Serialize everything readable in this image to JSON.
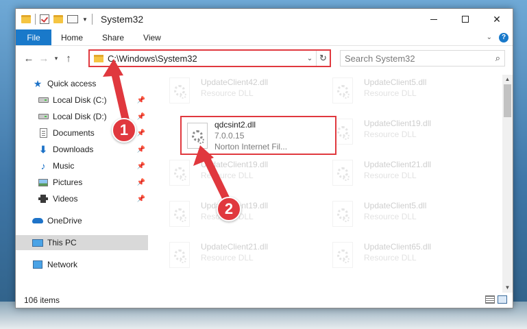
{
  "window": {
    "title": "System32",
    "min_glyph": "",
    "close_glyph": "✕"
  },
  "ribbon": {
    "tabs": [
      "File",
      "Home",
      "Share",
      "View"
    ]
  },
  "address": {
    "path": "C:\\Windows\\System32",
    "search_placeholder": "Search System32"
  },
  "sidebar": {
    "items": [
      {
        "label": "Quick access",
        "icon": "star-icon"
      },
      {
        "label": "Local Disk (C:)",
        "icon": "disk-icon",
        "pinned": true
      },
      {
        "label": "Local Disk (D:)",
        "icon": "disk-icon",
        "pinned": true
      },
      {
        "label": "Documents",
        "icon": "document-icon",
        "pinned": true
      },
      {
        "label": "Downloads",
        "icon": "download-icon",
        "pinned": true
      },
      {
        "label": "Music",
        "icon": "music-icon",
        "pinned": true
      },
      {
        "label": "Pictures",
        "icon": "pictures-icon",
        "pinned": true
      },
      {
        "label": "Videos",
        "icon": "videos-icon",
        "pinned": true
      },
      {
        "label": "OneDrive",
        "icon": "cloud-icon"
      },
      {
        "label": "This PC",
        "icon": "computer-icon",
        "selected": true
      },
      {
        "label": "Network",
        "icon": "network-icon"
      }
    ]
  },
  "files": {
    "highlighted": {
      "name": "qdcsint2.dll",
      "version": "7.0.0.15",
      "description": "Norton Internet Fil..."
    },
    "faded": [
      {
        "name": "UpdateClient42.dll",
        "type": "Resource DLL"
      },
      {
        "name": "UpdateClient5.dll",
        "type": "Resource DLL"
      },
      {
        "name": "UpdateClient19.dll",
        "type": "Resource DLL"
      },
      {
        "name": "UpdateClient19.dll",
        "type": "Resource DLL"
      },
      {
        "name": "UpdateClient21.dll",
        "type": "Resource DLL"
      },
      {
        "name": "UpdateClient19.dll",
        "type": "Resource DLL"
      },
      {
        "name": "UpdateClient5.dll",
        "type": "Resource DLL"
      },
      {
        "name": "UpdateClient21.dll",
        "type": "Resource DLL"
      },
      {
        "name": "UpdateClient65.dll",
        "type": "Resource DLL"
      }
    ]
  },
  "status": {
    "item_count": "106 items"
  },
  "annotations": {
    "step1": "1",
    "step2": "2",
    "color": "#e0383e"
  }
}
